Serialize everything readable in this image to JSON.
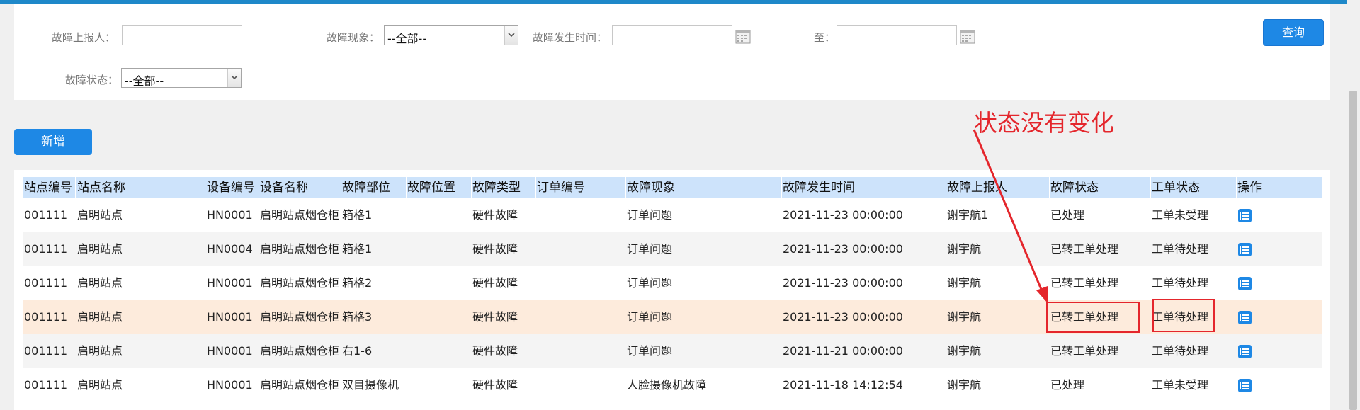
{
  "filters": {
    "reporter_label": "故障上报人：",
    "reporter_value": "",
    "phenomenon_label": "故障现象：",
    "phenomenon_value": "--全部--",
    "time_label": "故障发生时间：",
    "time_from": "",
    "to_label": "至：",
    "time_to": "",
    "status_label": "故障状态：",
    "status_value": "--全部--",
    "query_label": "查询"
  },
  "toolbar": {
    "add_label": "新增"
  },
  "table": {
    "headers": [
      "站点编号",
      "站点名称",
      "设备编号",
      "设备名称",
      "故障部位",
      "故障位置",
      "故障类型",
      "订单编号",
      "故障现象",
      "故障发生时间",
      "故障上报人",
      "故障状态",
      "工单状态",
      "操作"
    ],
    "rows": [
      [
        "001111",
        "启明站点",
        "HN0001",
        "启明站点烟仓柜",
        "箱格1",
        "",
        "硬件故障",
        "",
        "订单问题",
        "2021-11-23 00:00:00",
        "谢宇航1",
        "已处理",
        "工单未受理"
      ],
      [
        "001111",
        "启明站点",
        "HN0004",
        "启明站点烟仓柜",
        "箱格1",
        "",
        "硬件故障",
        "",
        "订单问题",
        "2021-11-23 00:00:00",
        "谢宇航",
        "已转工单处理",
        "工单待处理"
      ],
      [
        "001111",
        "启明站点",
        "HN0001",
        "启明站点烟仓柜",
        "箱格2",
        "",
        "硬件故障",
        "",
        "订单问题",
        "2021-11-23 00:00:00",
        "谢宇航",
        "已转工单处理",
        "工单待处理"
      ],
      [
        "001111",
        "启明站点",
        "HN0001",
        "启明站点烟仓柜",
        "箱格3",
        "",
        "硬件故障",
        "",
        "订单问题",
        "2021-11-23 00:00:00",
        "谢宇航",
        "已转工单处理",
        "工单待处理"
      ],
      [
        "001111",
        "启明站点",
        "HN0001",
        "启明站点烟仓柜",
        "右1-6",
        "",
        "硬件故障",
        "",
        "订单问题",
        "2021-11-21 00:00:00",
        "谢宇航",
        "已转工单处理",
        "工单待处理"
      ],
      [
        "001111",
        "启明站点",
        "HN0001",
        "启明站点烟仓柜",
        "双目摄像机",
        "",
        "硬件故障",
        "",
        "人脸摄像机故障",
        "2021-11-18 14:12:54",
        "谢宇航",
        "已处理",
        "工单未受理"
      ]
    ],
    "highlighted_row": 3
  },
  "annotation": {
    "text": "状态没有变化",
    "color": "#e4262c"
  },
  "colors": {
    "accent": "#1e88e5",
    "header_bg": "#cde3fb",
    "highlight_row": "#fdebdc",
    "topbar": "#1e88c9"
  }
}
